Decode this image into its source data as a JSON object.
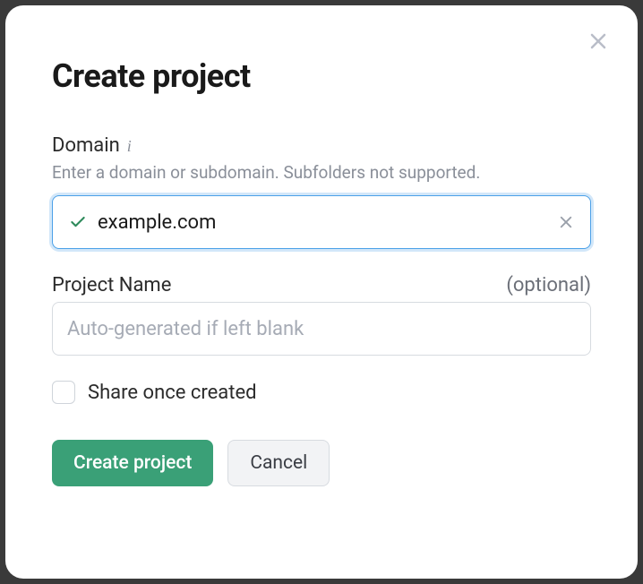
{
  "dialog": {
    "title": "Create project"
  },
  "domain_field": {
    "label": "Domain",
    "help": "Enter a domain or subdomain. Subfolders not supported.",
    "value": "example.com"
  },
  "name_field": {
    "label": "Project Name",
    "optional": "(optional)",
    "placeholder": "Auto-generated if left blank",
    "value": ""
  },
  "share": {
    "label": "Share once created",
    "checked": false
  },
  "buttons": {
    "primary": "Create project",
    "secondary": "Cancel"
  }
}
